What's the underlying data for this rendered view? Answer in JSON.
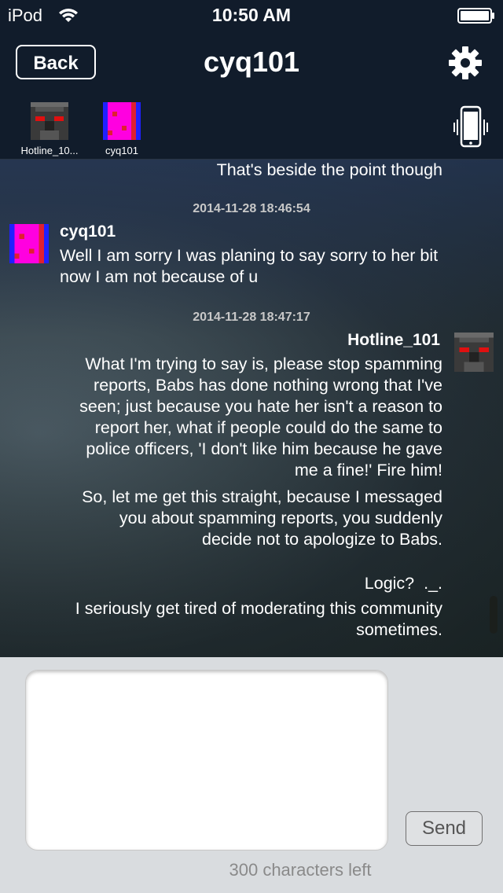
{
  "status_bar": {
    "carrier": "iPod",
    "time": "10:50 AM"
  },
  "nav": {
    "back_label": "Back",
    "title": "cyq101"
  },
  "members": [
    {
      "name": "Hotline_10..."
    },
    {
      "name": "cyq101"
    }
  ],
  "messages": {
    "m0": {
      "text": "That's beside the point though"
    },
    "m1": {
      "timestamp": "2014-11-28 18:46:54",
      "sender": "cyq101",
      "lines": [
        "Well I am sorry I was planing to say sorry to her bit",
        "now I am not because of u"
      ]
    },
    "m2": {
      "timestamp": "2014-11-28 18:47:17",
      "sender": "Hotline_101",
      "p1": [
        "What I'm trying to say is, please stop spamming",
        "reports, Babs has done nothing wrong that I've",
        "seen; just because you hate her isn't a reason to",
        "report her, what if people could do the same to",
        "police officers, 'I don't like him because he gave",
        "me a fine!' Fire him!"
      ],
      "p2": [
        "So, let me get this straight, because I messaged",
        "you about spamming reports, you suddenly",
        "decide not to apologize to Babs."
      ],
      "p3": [
        "Logic?  ._."
      ],
      "p4": [
        "I seriously get tired of moderating this community",
        "sometimes."
      ]
    }
  },
  "compose": {
    "text_value": "",
    "send_label": "Send",
    "chars_left": "300 characters left"
  },
  "icons": {
    "wifi": "wifi-icon",
    "battery": "battery-icon",
    "settings": "gear-icon",
    "vibrate": "phone-vibrate-icon"
  }
}
